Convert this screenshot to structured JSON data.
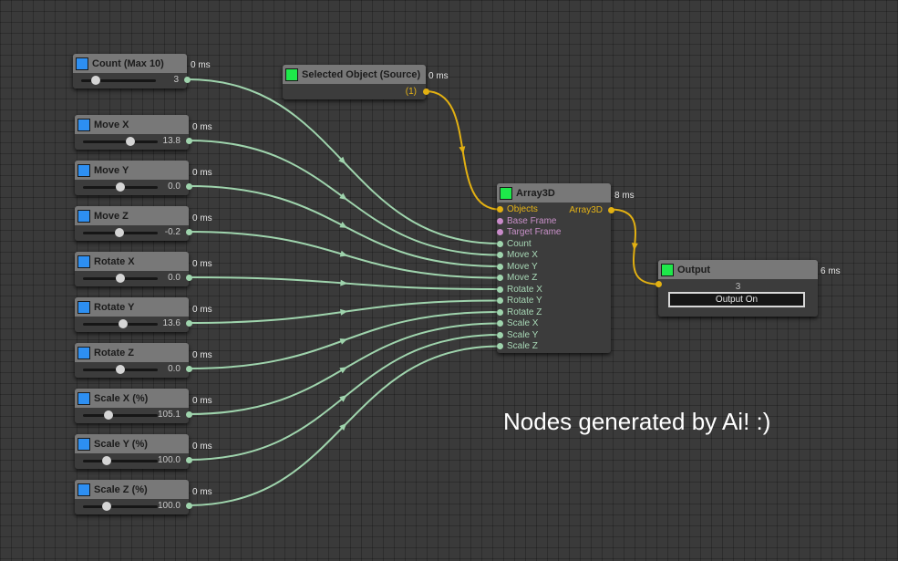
{
  "sliders": [
    {
      "title": "Count (Max 10)",
      "time": "0 ms",
      "value": "3",
      "fraction": 0.2
    },
    {
      "title": "Move X",
      "time": "0 ms",
      "value": "13.8",
      "fraction": 0.64
    },
    {
      "title": "Move Y",
      "time": "0 ms",
      "value": "0.0",
      "fraction": 0.5
    },
    {
      "title": "Move Z",
      "time": "0 ms",
      "value": "-0.2",
      "fraction": 0.49
    },
    {
      "title": "Rotate X",
      "time": "0 ms",
      "value": "0.0",
      "fraction": 0.5
    },
    {
      "title": "Rotate Y",
      "time": "0 ms",
      "value": "13.6",
      "fraction": 0.54
    },
    {
      "title": "Rotate Z",
      "time": "0 ms",
      "value": "0.0",
      "fraction": 0.5
    },
    {
      "title": "Scale X (%)",
      "time": "0 ms",
      "value": "105.1",
      "fraction": 0.34
    },
    {
      "title": "Scale Y (%)",
      "time": "0 ms",
      "value": "100.0",
      "fraction": 0.32
    },
    {
      "title": "Scale Z (%)",
      "time": "0 ms",
      "value": "100.0",
      "fraction": 0.32
    }
  ],
  "selected": {
    "title": "Selected Object (Source)",
    "time": "0 ms",
    "output": "(1)"
  },
  "array3d": {
    "title": "Array3D",
    "time": "8 ms",
    "output": "Array3D",
    "inputs": [
      "Objects",
      "Base Frame",
      "Target Frame",
      "Count",
      "Move X",
      "Move Y",
      "Move Z",
      "Rotate X",
      "Rotate Y",
      "Rotate Z",
      "Scale X",
      "Scale Y",
      "Scale Z"
    ],
    "input_kinds": [
      "y",
      "p",
      "p",
      "g",
      "g",
      "g",
      "g",
      "g",
      "g",
      "g",
      "g",
      "g",
      "g"
    ]
  },
  "output": {
    "title": "Output",
    "time": "6 ms",
    "value": "3",
    "button": "Output On"
  },
  "caption": "Nodes generated by Ai! :)",
  "colors": {
    "wire_green": "#9fd4ad",
    "wire_yellow": "#e2b012",
    "header_blue": "#2d8ff2",
    "header_green": "#1ee84a",
    "canvas": "#3a3a3a"
  },
  "icons": {
    "arrow": "arrowhead-icon"
  }
}
